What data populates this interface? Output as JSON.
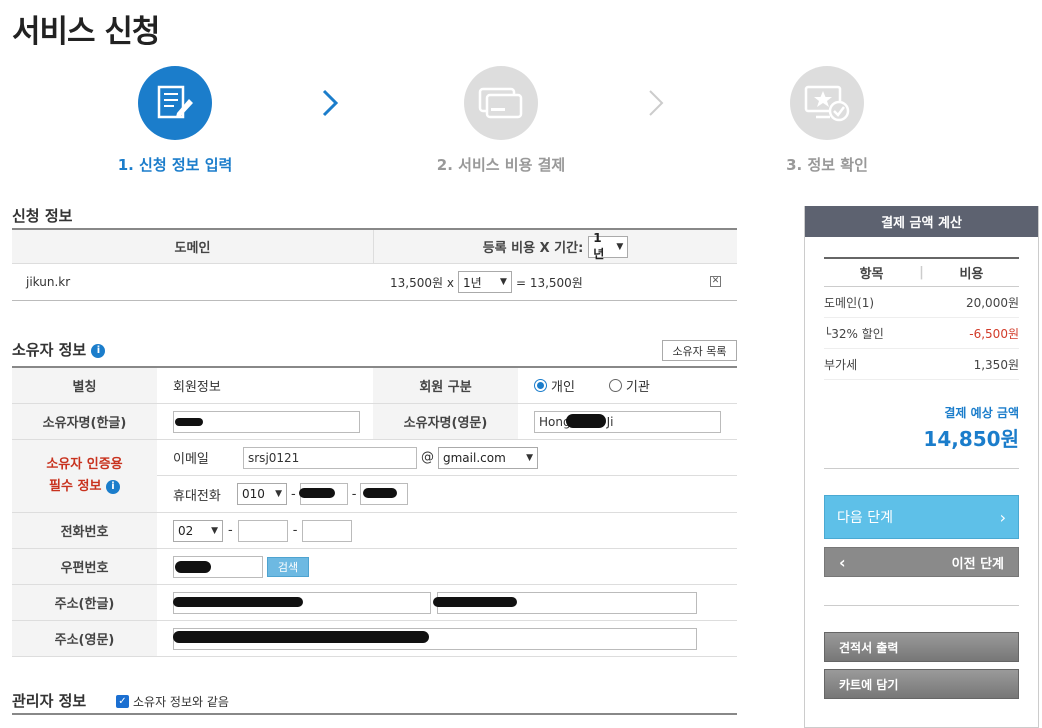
{
  "page_title": "서비스 신청",
  "steps": [
    {
      "label": "1. 신청 정보 입력",
      "state": "active"
    },
    {
      "label": "2. 서비스 비용 결제",
      "state": "inactive"
    },
    {
      "label": "3. 정보 확인",
      "state": "inactive"
    }
  ],
  "application": {
    "title": "신청 정보",
    "col_domain": "도메인",
    "col_cost": "등록 비용 X 기간:",
    "period_select": "1년",
    "row": {
      "domain": "jikun.kr",
      "price": "13,500원 x",
      "period": "1년",
      "total": "= 13,500원",
      "remove_icon": "close-icon"
    }
  },
  "owner": {
    "title": "소유자 정보",
    "list_button": "소유자 목록",
    "alias_label": "별칭",
    "alias_value": "회원정보",
    "member_type_label": "회원 구분",
    "member_type_options": [
      "개인",
      "기관"
    ],
    "member_type_selected": "개인",
    "name_ko_label": "소유자명(한글)",
    "name_en_label": "소유자명(영문)",
    "name_en_value": "Hong",
    "name_en_suffix": "Ji",
    "auth_label_1": "소유자 인증용",
    "auth_label_2": "필수 정보",
    "email_label": "이메일",
    "email_id": "srsj0121",
    "email_at": "@",
    "email_domain": "gmail.com",
    "mobile_label": "휴대전화",
    "mobile_prefix": "010",
    "dash": "-",
    "phone_label": "전화번호",
    "phone_prefix": "02",
    "zip_label": "우편번호",
    "zip_search_button": "검색",
    "addr_ko_label": "주소(한글)",
    "addr_en_label": "주소(영문)"
  },
  "admin": {
    "title": "관리자 정보",
    "same_as_owner": "소유자 정보와 같음",
    "same_checked": true
  },
  "sidebar": {
    "title": "결제 금액 계산",
    "col_item": "항목",
    "col_cost": "비용",
    "rows": [
      {
        "item": "도메인(1)",
        "cost": "20,000원",
        "color": "#444444"
      },
      {
        "item": "└32% 할인",
        "cost": "-6,500원",
        "color": "#d23c2a"
      },
      {
        "item": "부가세",
        "cost": "1,350원",
        "color": "#444444"
      }
    ],
    "total_label": "결제 예상 금액",
    "total_value": "14,850원",
    "next_button": "다음 단계",
    "prev_button": "이전 단계",
    "estimate_button": "견적서 출력",
    "cart_button": "카트에 담기"
  },
  "colors": {
    "accent": "#1b7dcb",
    "required": "#c8321e"
  }
}
